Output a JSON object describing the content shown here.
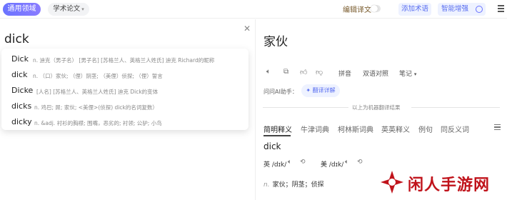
{
  "topbar": {
    "domain_btn": "通用领域",
    "paper_btn": "学术论文",
    "edit_translation": "编辑译文",
    "add_term": "添加术语",
    "smart_enhance": "智能增强"
  },
  "source": {
    "text": "dick"
  },
  "suggestions": [
    {
      "word": "Dick",
      "def": "n. 迪克（男子名） [男子名] [苏格兰人、英格兰人姓氏] 迪克 Richard的昵称"
    },
    {
      "word": "dick",
      "def": "n. （口）家伙; （俚）阴茎; （美俚）侦探; （俚）誓言"
    },
    {
      "word": "Dicke",
      "def": "[人名] [苏格兰人、英格兰人姓氏] 迪克 Dick的变体"
    },
    {
      "word": "dicks",
      "def": "n. 鸡巴; 屌; 家伙; <美俚>(侦探) dick的名词复数）"
    },
    {
      "word": "dicky",
      "def": "n. &adj. 衬衫的胸襟; 围嘴，恶劣的; 衬领; 公驴; 小鸟"
    }
  ],
  "target": {
    "text": "家伙"
  },
  "toolbar": {
    "pinyin": "拼音",
    "bilingual": "双语对照",
    "notes": "笔记"
  },
  "ai": {
    "label": "问问AI助手：",
    "button": "翻译详解"
  },
  "mt_note": "以上为机器翻译结果",
  "tabs": [
    "简明释义",
    "牛津词典",
    "柯林斯词典",
    "英英释义",
    "例句",
    "同反义词"
  ],
  "entry": {
    "word": "dick",
    "uk_label": "英",
    "uk_phon": "/dɪk/",
    "us_label": "美",
    "us_phon": "/dɪk/",
    "pos": "n.",
    "meaning": "家伙；阴茎；侦探"
  },
  "watermark": {
    "text": "闲人手游网"
  }
}
